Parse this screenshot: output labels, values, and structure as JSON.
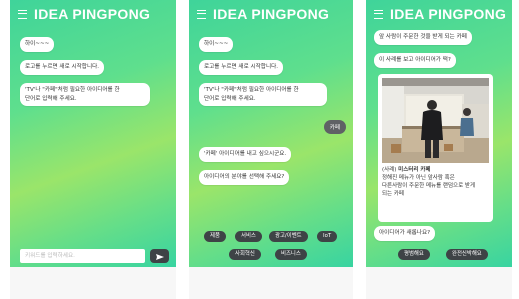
{
  "app": {
    "title": "IDEA PINGPONG"
  },
  "screen1": {
    "messages": [
      "하이~~~",
      "로고를 누르면 새로 시작합니다.",
      "'TV'나 \"카페\"처럼 필요한 아이디어를 한",
      "단어로 입력해 주세요."
    ],
    "input_placeholder": "키워드를 입력하세요."
  },
  "screen2": {
    "messages": [
      "하이~~~",
      "로고를 누르면 새로 시작합니다.",
      "'TV'나 \"카페\"처럼 필요한 아이디어를 한",
      "단어로 입력해 주세요."
    ],
    "user_reply": "카페",
    "bot_reply1": "'카페' 아이디어를 내고 싶으시군요.",
    "bot_reply2": "아이디어의 분야를 선택해 주세요?",
    "chips": [
      "제품",
      "서비스",
      "광고/이벤트",
      "IoT",
      "사회혁신",
      "비즈니스"
    ]
  },
  "screen3": {
    "msg1": "앞 사람이 주문한 것을 받게 되는 카페",
    "msg2": "이 사례를 보고 아이디어가 떡?",
    "card": {
      "tag": "(사례)",
      "name": "미스터리 카페",
      "lines": [
        "정해진 메뉴가 아닌 앞사람 혹은",
        "다른사람이 주문한 메뉴를 랜덤으로 받게",
        "되는 카페"
      ]
    },
    "question": "아이디어가 새롭나요?",
    "btn_rate": "평범해요",
    "btn_new": "완전신박해요"
  },
  "colors": {
    "accent_dark": "#3e4346",
    "user_bubble": "#5f6165"
  }
}
